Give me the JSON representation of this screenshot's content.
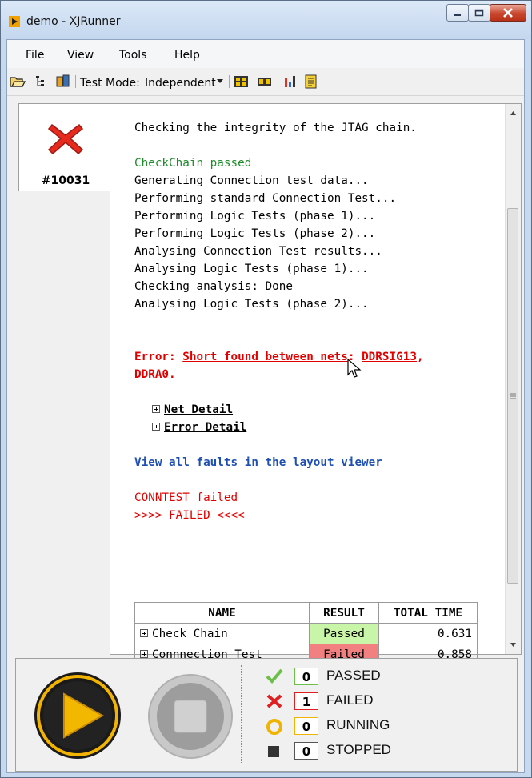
{
  "window": {
    "title": "demo - XJRunner"
  },
  "menu": {
    "items": [
      "File",
      "View",
      "Tools",
      "Help"
    ]
  },
  "toolbar": {
    "test_mode_label": "Test Mode:",
    "test_mode_value": "Independent"
  },
  "tab": {
    "label": "#10031"
  },
  "log": {
    "line_intro": "Checking the integrity of the JTAG chain.",
    "line_passed": "CheckChain passed",
    "lines": [
      "Generating Connection test data...",
      "Performing standard Connection Test...",
      "Performing Logic Tests (phase 1)...",
      "Performing Logic Tests (phase 2)...",
      "Analysing Connection Test results...",
      "Analysing Logic Tests (phase 1)...",
      "Checking analysis: Done",
      "Analysing Logic Tests (phase 2)..."
    ],
    "error_prefix": "Error: ",
    "error_link": "Short found between nets",
    "error_colon": ": ",
    "error_net1": "DDRSIG13",
    "error_comma": ",",
    "error_net2": "DDRA0",
    "error_period": ".",
    "net_detail": "Net Detail",
    "error_detail": "Error Detail",
    "view_faults": "View all faults in the layout viewer",
    "conntest_failed": "CONNTEST failed",
    "failed_banner": ">>>> FAILED <<<<"
  },
  "results_table": {
    "headers": [
      "NAME",
      "RESULT",
      "TOTAL TIME"
    ],
    "rows": [
      {
        "name": "Check Chain",
        "result": "Passed",
        "time": "0.631"
      },
      {
        "name": "Connnection Test",
        "result": "Failed",
        "time": "0.858"
      }
    ]
  },
  "status": {
    "passed": {
      "count": "0",
      "label": "PASSED",
      "color": "#5cb85c"
    },
    "failed": {
      "count": "1",
      "label": "FAILED",
      "color": "#e02020"
    },
    "running": {
      "count": "0",
      "label": "RUNNING",
      "color": "#f0b400"
    },
    "stopped": {
      "count": "0",
      "label": "STOPPED",
      "color": "#333333"
    }
  },
  "icons": {
    "play": "play-icon",
    "stop": "stop-icon",
    "tab_status": "red-x-icon"
  }
}
